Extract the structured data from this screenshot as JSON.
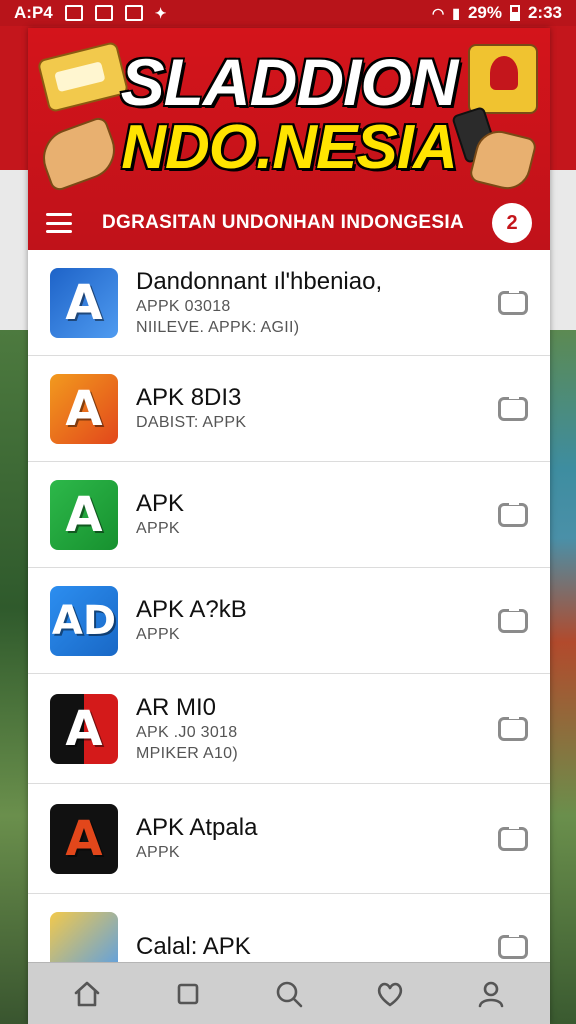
{
  "status_bar": {
    "carrier": "A:P4",
    "battery": "29%",
    "time": "2:33"
  },
  "header": {
    "title_line1": "SLADDION",
    "title_line2": "NDO.NESIA",
    "subtitle": "DGRASITAN UNDONHAN INDONGESIA",
    "profile_glyph": "2",
    "brand_red": "#c4161c",
    "brand_yellow": "#ffe400"
  },
  "apps": [
    {
      "name": "Dandonnant ıl'hbeniao,",
      "line1": "APPK 03018",
      "line2": "NIILEVE. APPK: AGII)",
      "icon_glyph": "A",
      "icon_colors": [
        "#1e63c8",
        "#4f9bf0"
      ]
    },
    {
      "name": "APK 8DI3",
      "line1": "DABIST: APPK",
      "line2": "",
      "icon_glyph": "A",
      "icon_colors": [
        "#f29a1e",
        "#e2471b"
      ]
    },
    {
      "name": "APK",
      "line1": "APPK",
      "line2": "",
      "icon_glyph": "A",
      "icon_colors": [
        "#2db84a",
        "#17912f"
      ]
    },
    {
      "name": "APK A?kB",
      "line1": "APPK",
      "line2": "",
      "icon_glyph": "AD",
      "icon_colors": [
        "#2c8ef0",
        "#1968c6"
      ]
    },
    {
      "name": "AR MI0",
      "line1": "APK .J0 3018",
      "line2": "MPIKER A10)",
      "icon_glyph": "A",
      "icon_colors": [
        "#111111",
        "#d41a1a"
      ]
    },
    {
      "name": "APK Atpala",
      "line1": "APPK",
      "line2": "",
      "icon_glyph": "A",
      "icon_colors": [
        "#111111",
        "#222222"
      ]
    },
    {
      "name": "Calal: APK",
      "line1": "",
      "line2": "",
      "icon_glyph": "",
      "icon_colors": [
        "#f2c94c",
        "#4f9bf0"
      ]
    }
  ],
  "bottom_nav": [
    "home-icon",
    "square-icon",
    "search-icon",
    "heart-icon",
    "profile-icon"
  ]
}
